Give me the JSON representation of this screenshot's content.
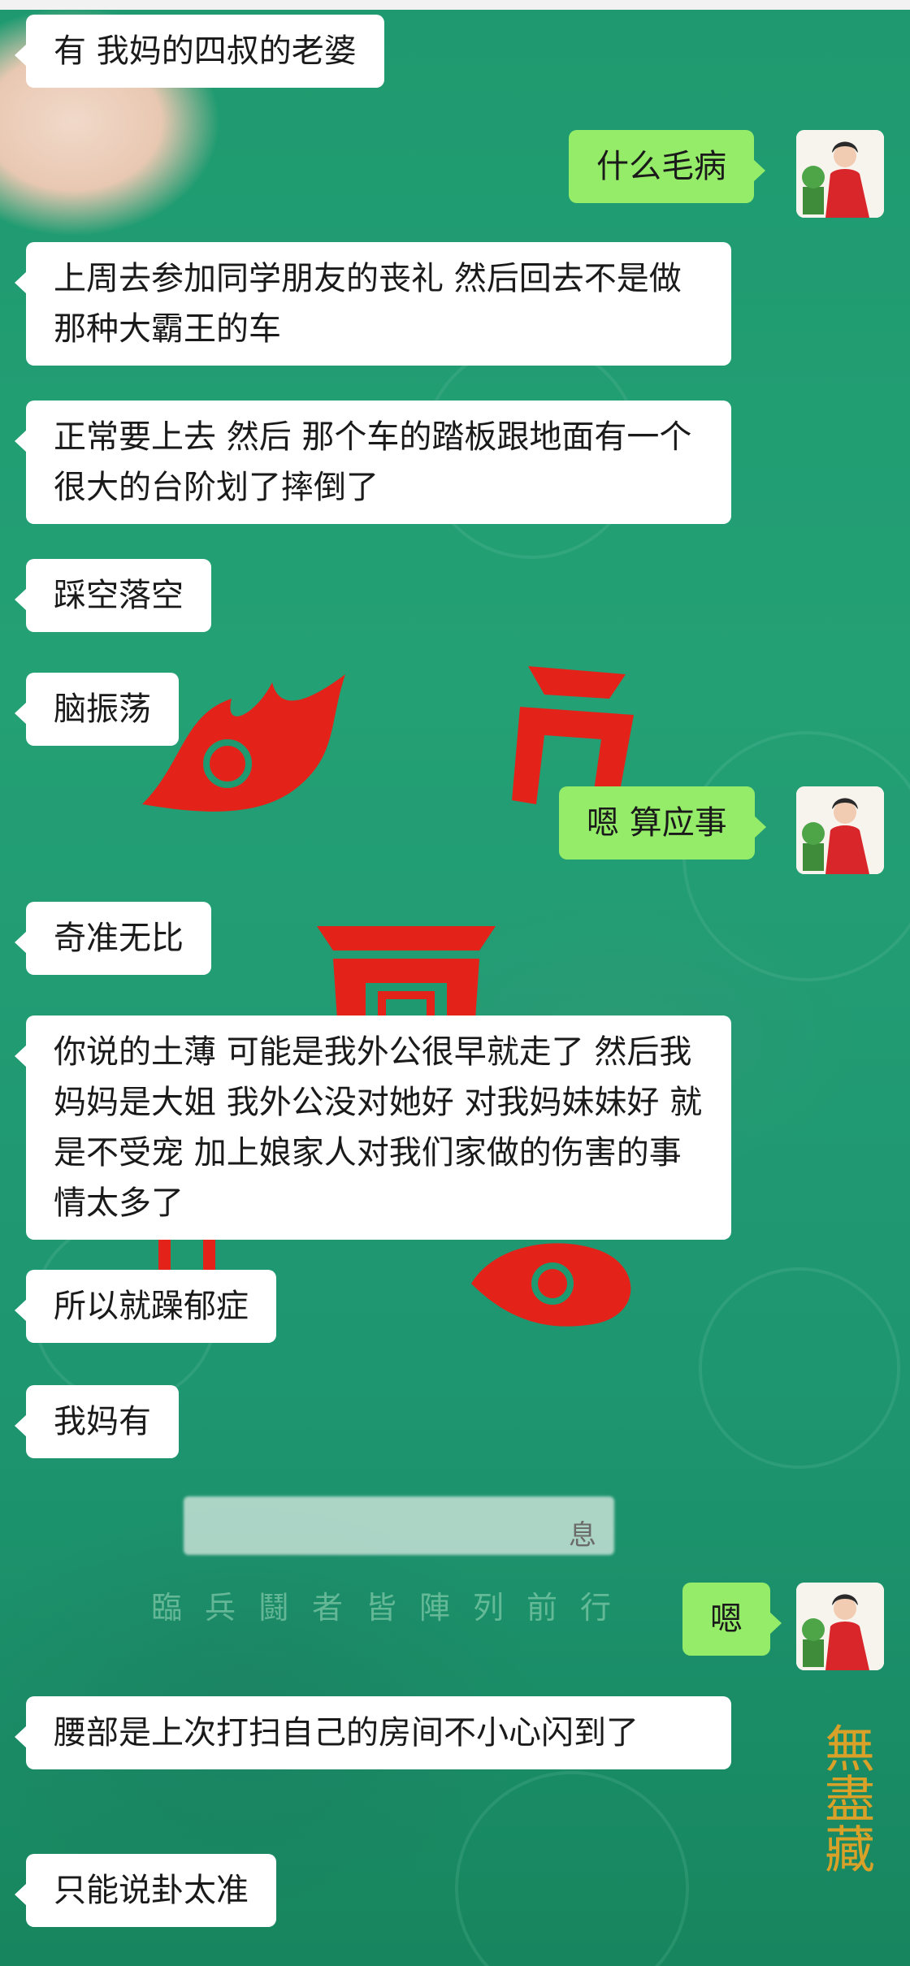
{
  "messages": [
    {
      "side": "left",
      "text": "有 我妈的四叔的老婆"
    },
    {
      "side": "right",
      "text": "什么毛病"
    },
    {
      "side": "left",
      "text": "上周去参加同学朋友的丧礼 然后回去不是做那种大霸王的车"
    },
    {
      "side": "left",
      "text": "正常要上去 然后 那个车的踏板跟地面有一个很大的台阶划了摔倒了"
    },
    {
      "side": "left",
      "text": "踩空落空"
    },
    {
      "side": "left",
      "text": "脑振荡"
    },
    {
      "side": "right",
      "text": "嗯 算应事"
    },
    {
      "side": "left",
      "text": "奇准无比"
    },
    {
      "side": "left",
      "text": "你说的土薄 可能是我外公很早就走了 然后我妈妈是大姐 我外公没对她好 对我妈妹妹好 就是不受宠 加上娘家人对我们家做的伤害的事情太多了"
    },
    {
      "side": "left",
      "text": "所以就躁郁症"
    },
    {
      "side": "left",
      "text": "我妈有"
    },
    {
      "side": "right",
      "text": "嗯"
    },
    {
      "side": "left",
      "text": "腰部是上次打扫自己的房间不小心闪到了"
    },
    {
      "side": "left",
      "text": "只能说卦太准"
    }
  ],
  "system_message": {
    "visible_tail": "息"
  },
  "background": {
    "watermark_text": "臨兵鬪者皆陣列前行",
    "seal_text": "無盡藏"
  },
  "avatar": {
    "icon": "profile-avatar-icon"
  },
  "colors": {
    "chat_bg": "#1f9a70",
    "bubble_left": "#ffffff",
    "bubble_right": "#95ec69"
  }
}
